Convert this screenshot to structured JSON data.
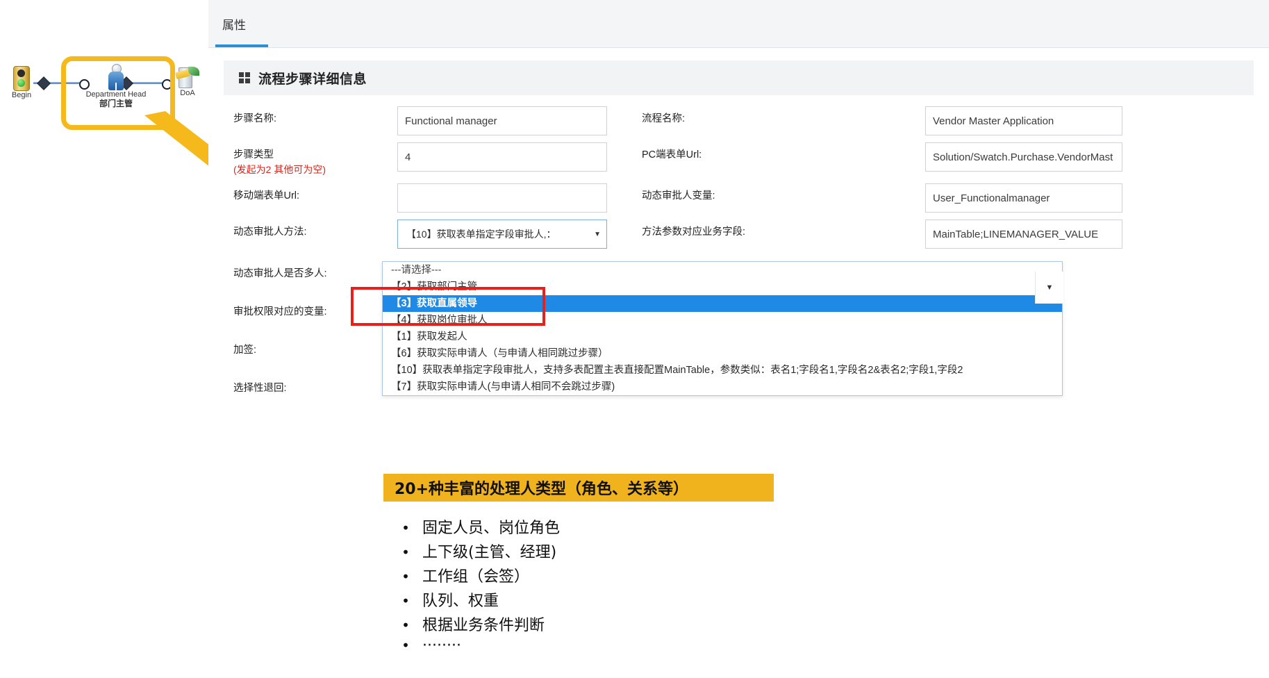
{
  "diagram": {
    "nodes": [
      {
        "name": "Begin",
        "caption_en": "Begin",
        "caption_cn": "",
        "icon": "traffic-light-icon"
      },
      {
        "name": "Department Head",
        "caption_en": "Department Head",
        "caption_cn": "部门主管",
        "icon": "person-icon"
      },
      {
        "name": "DoA",
        "caption_en": "DoA",
        "caption_cn": "",
        "icon": "doa-approval-icon"
      }
    ],
    "callout_target": "Department Head 部门主管",
    "callout_color": "#f5b91b"
  },
  "panel": {
    "tab_label": "属性",
    "accent_color": "#2b8fd6",
    "section_title": "流程步骤详细信息",
    "fields": {
      "step_name_label": "步骤名称:",
      "step_name_value": "Functional manager",
      "step_type_label": "步骤类型",
      "step_type_note": "(发起为2 其他可为空)",
      "step_type_value": "4",
      "mobile_url_label": "移动端表单Url:",
      "mobile_url_value": "",
      "dynamic_method_label": "动态审批人方法:",
      "dynamic_method_value": "【10】获取表单指定字段审批人,：",
      "dynamic_multi_label": "动态审批人是否多人:",
      "dynamic_multi_value": "",
      "approve_var_label": "审批权限对应的变量:",
      "countersign_label": "加签:",
      "selective_return_label": "选择性退回:",
      "process_name_label": "流程名称:",
      "process_name_value": "Vendor Master Application",
      "pc_url_label": "PC端表单Url:",
      "pc_url_value": "Solution/Swatch.Purchase.VendorMast",
      "dynamic_var_label": "动态审批人变量:",
      "dynamic_var_value": "User_Functionalmanager",
      "method_param_label": "方法参数对应业务字段:",
      "method_param_value": "MainTable;LINEMANAGER_VALUE"
    },
    "dropdown": {
      "options": [
        "---请选择---",
        "【2】获取部门主管",
        "【3】获取直属领导",
        "【4】获取岗位审批人",
        "【1】获取发起人",
        "【6】获取实际申请人（与申请人相同跳过步骤）",
        "【10】获取表单指定字段审批人，支持多表配置主表直接配置MainTable，参数类似：表名1;字段名1,字段名2&表名2;字段1,字段2",
        "【7】获取实际申请人(与申请人相同不会跳过步骤)"
      ],
      "selected_index": 2,
      "selected_color": "#1e8ae5",
      "highlight_color": "#e8201a"
    }
  },
  "bottom": {
    "banner_text": "20+种丰富的处理人类型（角色、关系等）",
    "banner_color": "#f0b21d",
    "bullets": [
      "固定人员、岗位角色",
      "上下级(主管、经理)",
      "工作组（会签）",
      "队列、权重",
      "根据业务条件判断",
      "········"
    ],
    "bullet_marker": "•"
  }
}
